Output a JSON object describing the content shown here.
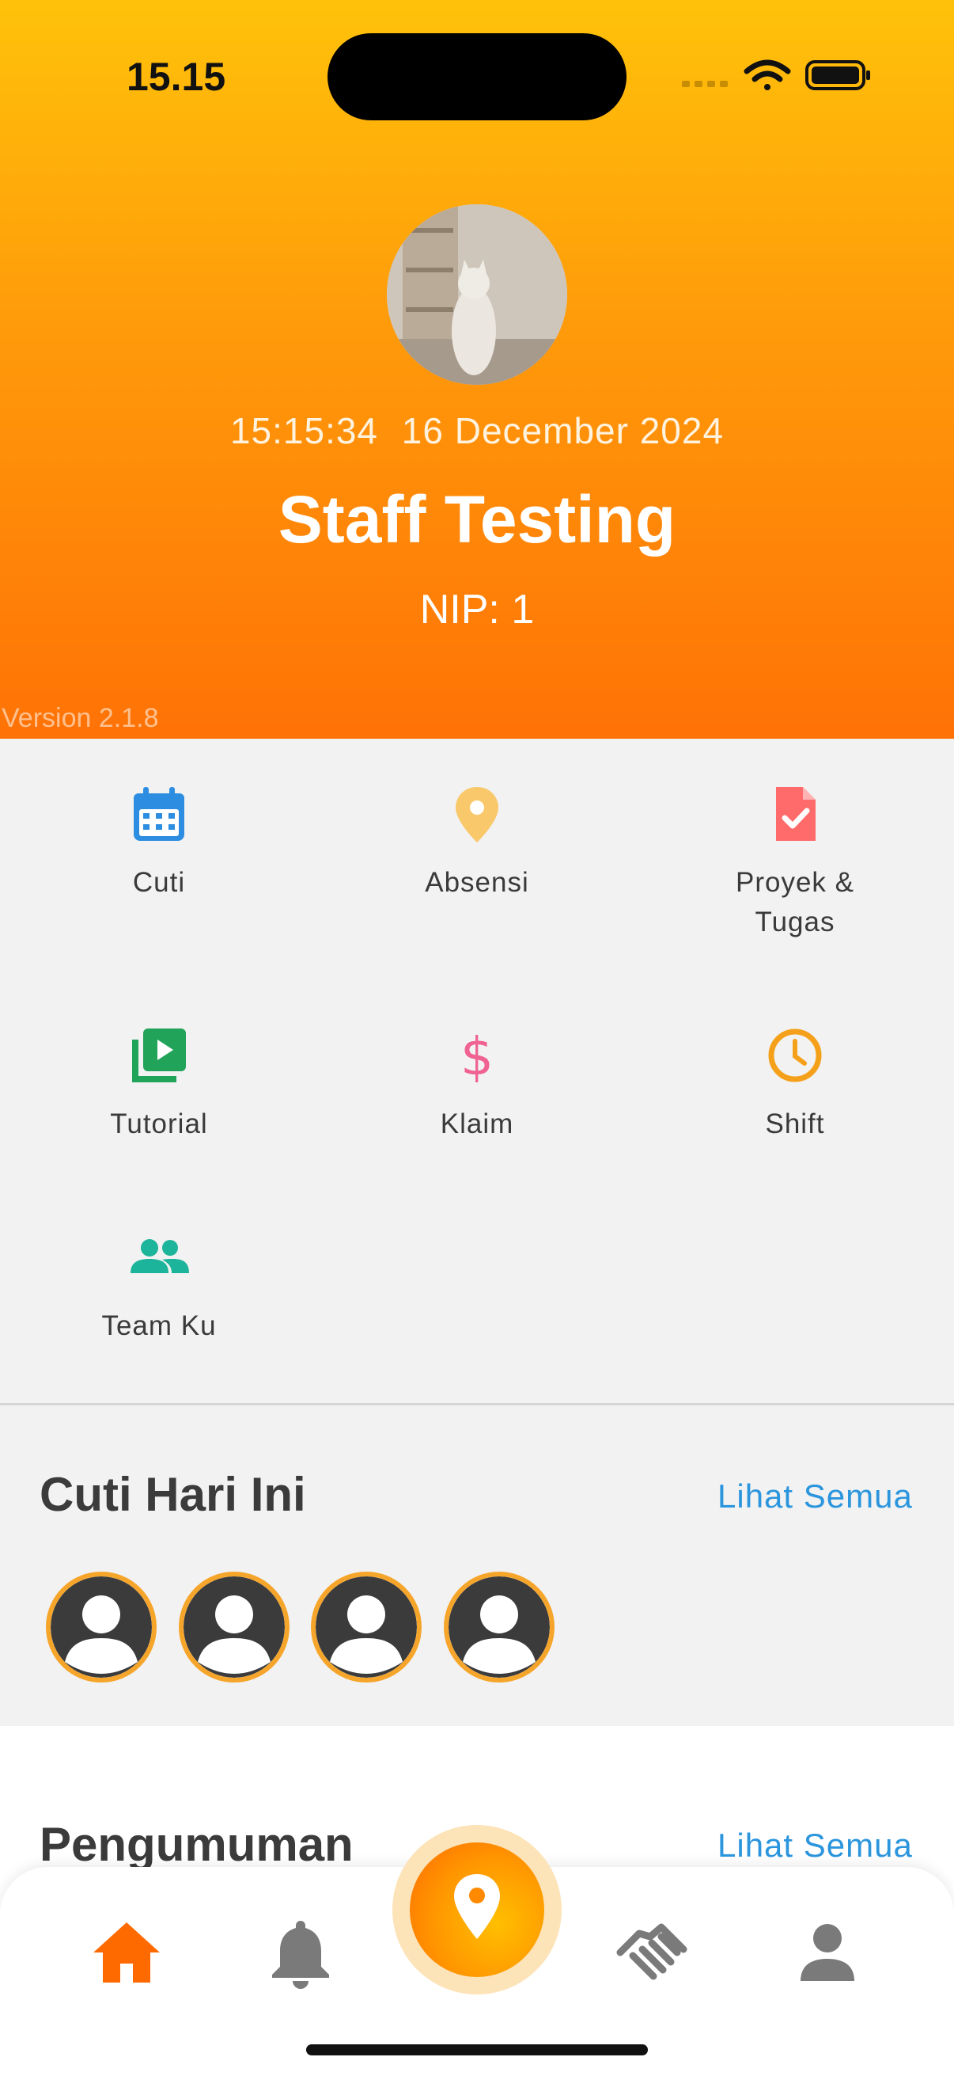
{
  "status_bar": {
    "time": "15.15"
  },
  "profile": {
    "time": "15:15:34",
    "date": "16 December 2024",
    "name": "Staff Testing",
    "nip": "NIP: 1",
    "version": "Version 2.1.8"
  },
  "menu": {
    "items": [
      {
        "label": "Cuti",
        "icon": "calendar-icon",
        "color": "#2d8de0"
      },
      {
        "label": "Absensi",
        "icon": "location-pin-icon",
        "color": "#f9c86a"
      },
      {
        "label": "Proyek &\nTugas",
        "icon": "document-check-icon",
        "color": "#ff6b6b"
      },
      {
        "label": "Tutorial",
        "icon": "video-library-icon",
        "color": "#21a35a"
      },
      {
        "label": "Klaim",
        "icon": "dollar-icon",
        "color": "#f06292"
      },
      {
        "label": "Shift",
        "icon": "clock-icon",
        "color": "#f5a01a"
      },
      {
        "label": "Team Ku",
        "icon": "team-icon",
        "color": "#1cb49a"
      }
    ]
  },
  "leave_today": {
    "title": "Cuti Hari Ini",
    "see_all": "Lihat Semua",
    "avatar_count": 4
  },
  "announcements": {
    "title": "Pengumuman",
    "see_all": "Lihat Semua"
  },
  "bottom_nav": {
    "items": [
      "home-icon",
      "bell-icon",
      "attendance-pin-icon",
      "handshake-icon",
      "person-icon"
    ],
    "active_color": "#ff6a00",
    "inactive_color": "#7a7a7a"
  }
}
